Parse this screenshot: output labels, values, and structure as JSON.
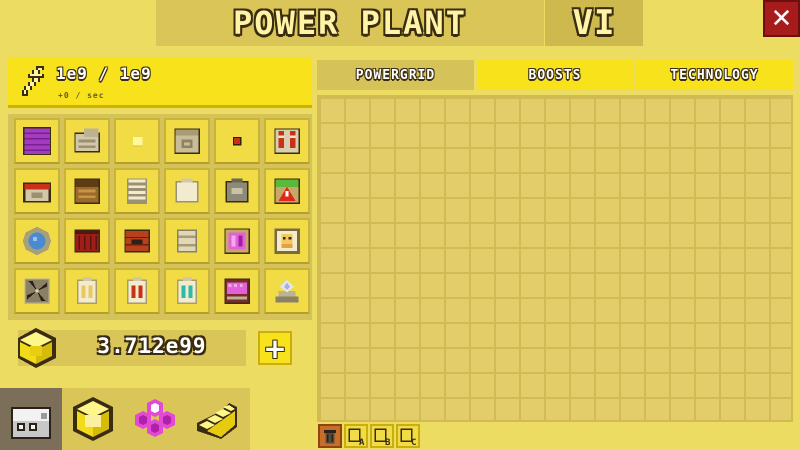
{
  "header": {
    "title": "POWER PLANT",
    "level": "VI",
    "close_label": "✕"
  },
  "energy": {
    "value": "1e9 / 1e9",
    "rate": "+0 / sec",
    "icon": "lightning-bolt-icon"
  },
  "items": [
    {
      "name": "purple-panel-icon"
    },
    {
      "name": "stone-steps-icon"
    },
    {
      "name": "small-yellow-cube-icon"
    },
    {
      "name": "stone-machine-icon"
    },
    {
      "name": "red-dot-icon"
    },
    {
      "name": "red-twin-pillar-icon"
    },
    {
      "name": "red-anvil-icon"
    },
    {
      "name": "wooden-crate-icon"
    },
    {
      "name": "coil-spring-icon"
    },
    {
      "name": "white-canister-icon"
    },
    {
      "name": "gray-urn-icon"
    },
    {
      "name": "warning-green-box-icon"
    },
    {
      "name": "blue-orb-icon"
    },
    {
      "name": "red-vent-block-icon"
    },
    {
      "name": "brick-generator-icon"
    },
    {
      "name": "stone-barrel-icon"
    },
    {
      "name": "pink-crystal-box-icon"
    },
    {
      "name": "portrait-frame-icon"
    },
    {
      "name": "fan-turbine-icon"
    },
    {
      "name": "yellow-battery-icon"
    },
    {
      "name": "red-battery-icon"
    },
    {
      "name": "cyan-battery-icon"
    },
    {
      "name": "pink-circuit-box-icon"
    },
    {
      "name": "crystal-fountain-icon"
    }
  ],
  "currency": {
    "value": "3.712e99",
    "icon": "yellow-cube-icon",
    "add_label": "+"
  },
  "category_tabs": [
    {
      "name": "robot-head-icon",
      "active": true
    },
    {
      "name": "yellow-cubes-icon",
      "active": false
    },
    {
      "name": "pink-hexagons-icon",
      "active": false
    },
    {
      "name": "yellow-stairs-icon",
      "active": false
    }
  ],
  "tabs": [
    {
      "label": "POWERGRID",
      "active": true
    },
    {
      "label": "BOOSTS",
      "active": false
    },
    {
      "label": "TECHNOLOGY",
      "active": false
    }
  ],
  "grid_buttons": [
    {
      "name": "trash-icon"
    },
    {
      "name": "save-slot-a-icon",
      "letter": "A"
    },
    {
      "name": "save-slot-b-icon",
      "letter": "B"
    },
    {
      "name": "save-slot-c-icon",
      "letter": "C"
    }
  ],
  "colors": {
    "background": "#eddc62",
    "panel": "#d9c558",
    "accent_yellow": "#f8e21c",
    "close_red": "#a61c1c"
  }
}
